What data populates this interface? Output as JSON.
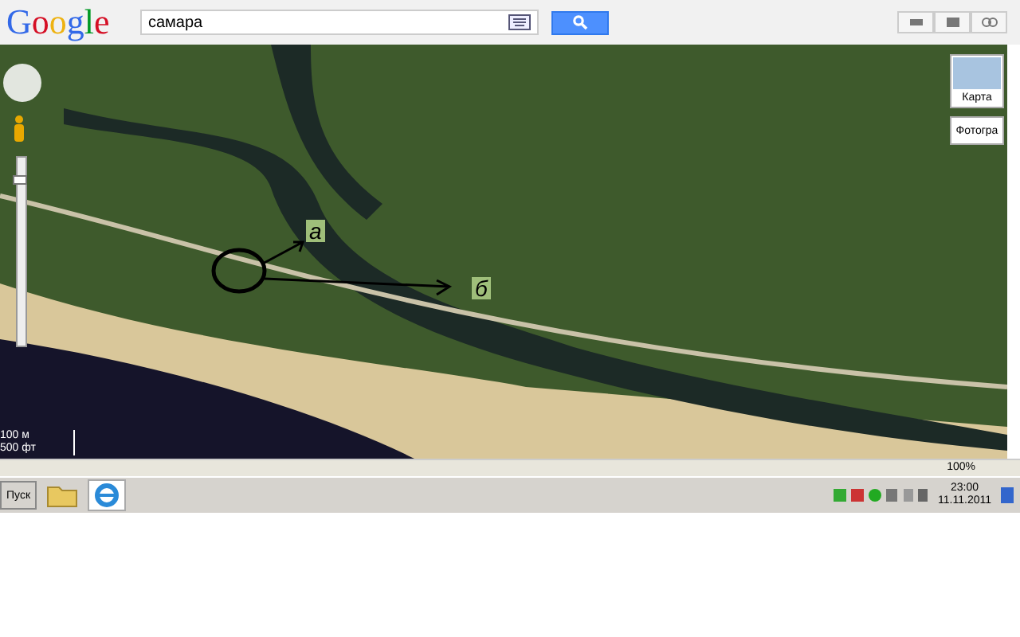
{
  "header": {
    "logo": "Google",
    "search": {
      "value": "самара"
    }
  },
  "map": {
    "map_type_buttons": [
      {
        "label": "Карта",
        "kind": "thumb"
      },
      {
        "label": "Фотогра",
        "kind": "menu"
      }
    ],
    "zoom_slider": {
      "level": 0.9
    },
    "annotations": [
      {
        "label": "а"
      },
      {
        "label": "б"
      }
    ],
    "scale": [
      "100 м",
      "500 фт"
    ]
  },
  "browser_status": {
    "zoom": "100%"
  },
  "taskbar": {
    "start": "Пуск",
    "time": "23:00",
    "date": "11.11.2011"
  }
}
